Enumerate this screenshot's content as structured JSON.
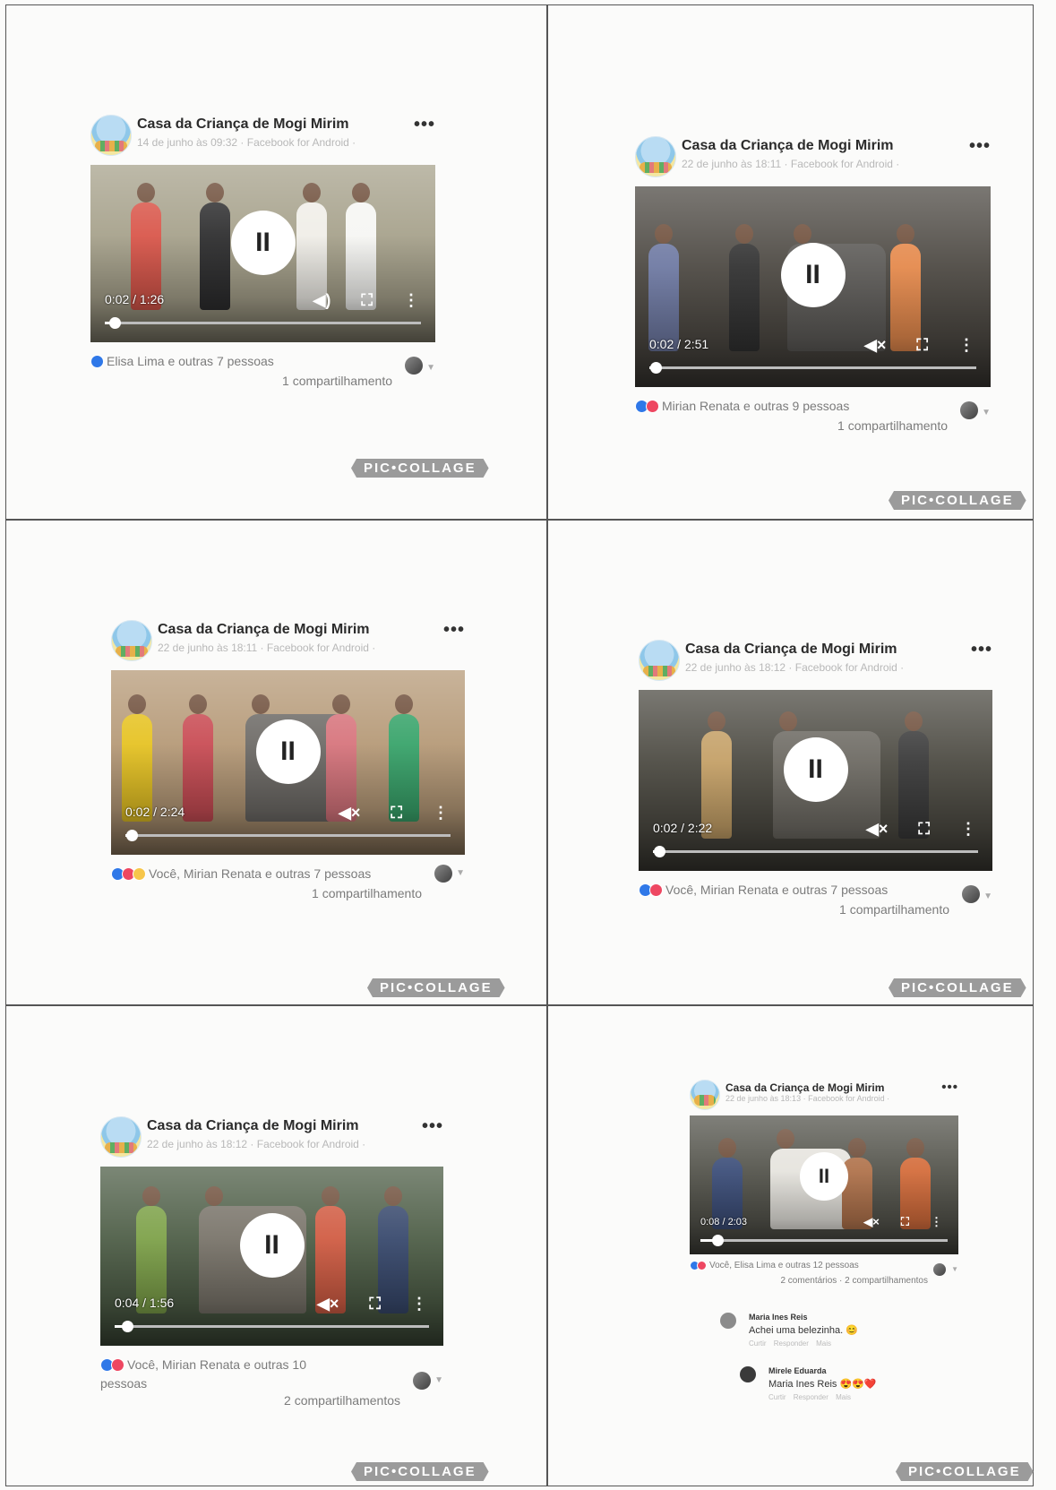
{
  "page": {
    "page_name": "Casa da Criança de Mogi Mirim",
    "more_label": "•••",
    "pause_glyph": "II",
    "ctrl_volume": "◀)",
    "ctrl_muted": "◀×",
    "ctrl_fullscreen": "⛶",
    "ctrl_menu": "⋮",
    "watermark": "PIC•COLLAGE"
  },
  "posts": [
    {
      "meta": "14 de junho às 09:32 · Facebook for Android · ",
      "time": "0:02 / 1:26",
      "progress": 0.03,
      "muted": false,
      "reactions": [
        "like"
      ],
      "reaction_text": "Elisa Lima e outras 7 pessoas",
      "shares": "1 compartilhamento"
    },
    {
      "meta": "22 de junho às 18:11 · Facebook for Android · ",
      "time": "0:02 / 2:51",
      "progress": 0.02,
      "muted": true,
      "reactions": [
        "like",
        "love"
      ],
      "reaction_text": "Mirian Renata e outras 9 pessoas",
      "shares": "1 compartilhamento"
    },
    {
      "meta": "22 de junho às 18:11 · Facebook for Android · ",
      "time": "0:02 / 2:24",
      "progress": 0.02,
      "muted": true,
      "reactions": [
        "like",
        "love",
        "wow"
      ],
      "reaction_text": "Você, Mirian Renata e outras 7 pessoas",
      "shares": "1 compartilhamento"
    },
    {
      "meta": "22 de junho às 18:12 · Facebook for Android · ",
      "time": "0:02 / 2:22",
      "progress": 0.02,
      "muted": true,
      "reactions": [
        "like",
        "love"
      ],
      "reaction_text": "Você, Mirian Renata e outras 7 pessoas",
      "shares": "1 compartilhamento"
    },
    {
      "meta": "22 de junho às 18:12 · Facebook for Android · ",
      "time": "0:04 / 1:56",
      "progress": 0.04,
      "muted": true,
      "reactions": [
        "like",
        "love"
      ],
      "reaction_text": "Você, Mirian Renata e outras 10 pessoas",
      "shares": "2 compartilhamentos"
    },
    {
      "meta": "22 de junho às 18:13 · Facebook for Android · ",
      "time": "0:08 / 2:03",
      "progress": 0.07,
      "muted": true,
      "reactions": [
        "like",
        "love"
      ],
      "reaction_text": "Você, Elisa Lima e outras 12 pessoas",
      "shares": "2 comentários · 2 compartilhamentos",
      "comments": [
        {
          "name": "Maria Ines Reis",
          "text": "Achei uma belezinha. 😊",
          "actions": "Curtir  Responder  Mais"
        },
        {
          "name": "Mirele Eduarda",
          "text": "Maria Ines Reis 😍😍❤️",
          "actions": "Curtir  Responder  Mais"
        }
      ]
    }
  ],
  "colors": {
    "like": "#2f78e8",
    "love": "#ee4761",
    "wow": "#f7c64a",
    "grid": "#555555"
  }
}
